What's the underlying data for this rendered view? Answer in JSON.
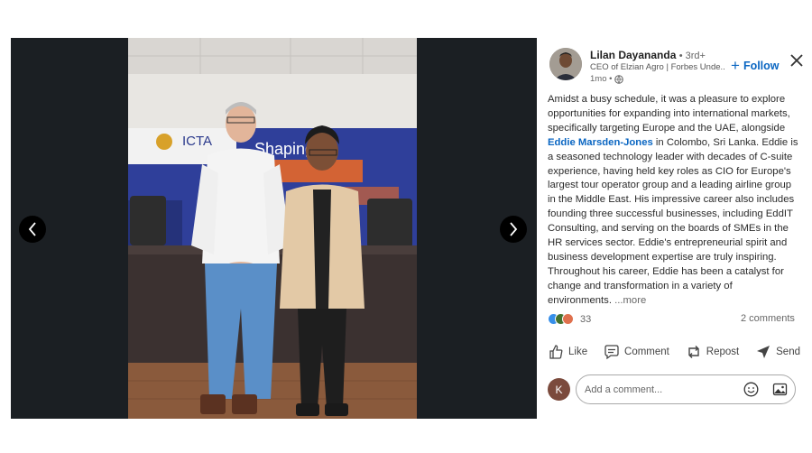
{
  "viewer": {
    "photo_banner_brand": "ICTA",
    "photo_banner_text": "Shaping"
  },
  "post": {
    "author_name": "Lilan Dayananda",
    "author_degree": "• 3rd+",
    "author_headline": "CEO of Elzian Agro | Forbes Unde...",
    "time": "1mo •",
    "follow_label": "Follow",
    "text_before_mention": "Amidst a busy schedule, it was a pleasure to explore opportunities for expanding into international markets, specifically targeting Europe and the UAE, alongside ",
    "mention": "Eddie Marsden-Jones",
    "text_after_mention": " in Colombo, Sri Lanka. Eddie is a seasoned technology leader with decades of C-suite experience, having held key roles as CIO for Europe's largest tour operator group and a leading airline group in the Middle East. His impressive career also includes founding three successful businesses, including EddIT Consulting, and serving on the boards of SMEs in the HR services sector. Eddie's entrepreneurial spirit and business development expertise are truly inspiring. Throughout his career, Eddie has been a catalyst for change and transformation in a variety of environments.",
    "more_label": "...more",
    "reaction_count": "33",
    "comments_count": "2 comments"
  },
  "actions": {
    "like": "Like",
    "comment": "Comment",
    "repost": "Repost",
    "send": "Send"
  },
  "comment_box": {
    "avatar_initial": "K",
    "placeholder": "Add a comment..."
  },
  "icons": [
    "chevron-left-icon",
    "chevron-right-icon",
    "close-icon",
    "globe-icon",
    "like-icon",
    "comment-icon",
    "repost-icon",
    "send-icon",
    "emoji-icon",
    "image-icon"
  ],
  "colors": {
    "accent": "#0a66c2",
    "viewer_bg": "#1b1f23"
  }
}
